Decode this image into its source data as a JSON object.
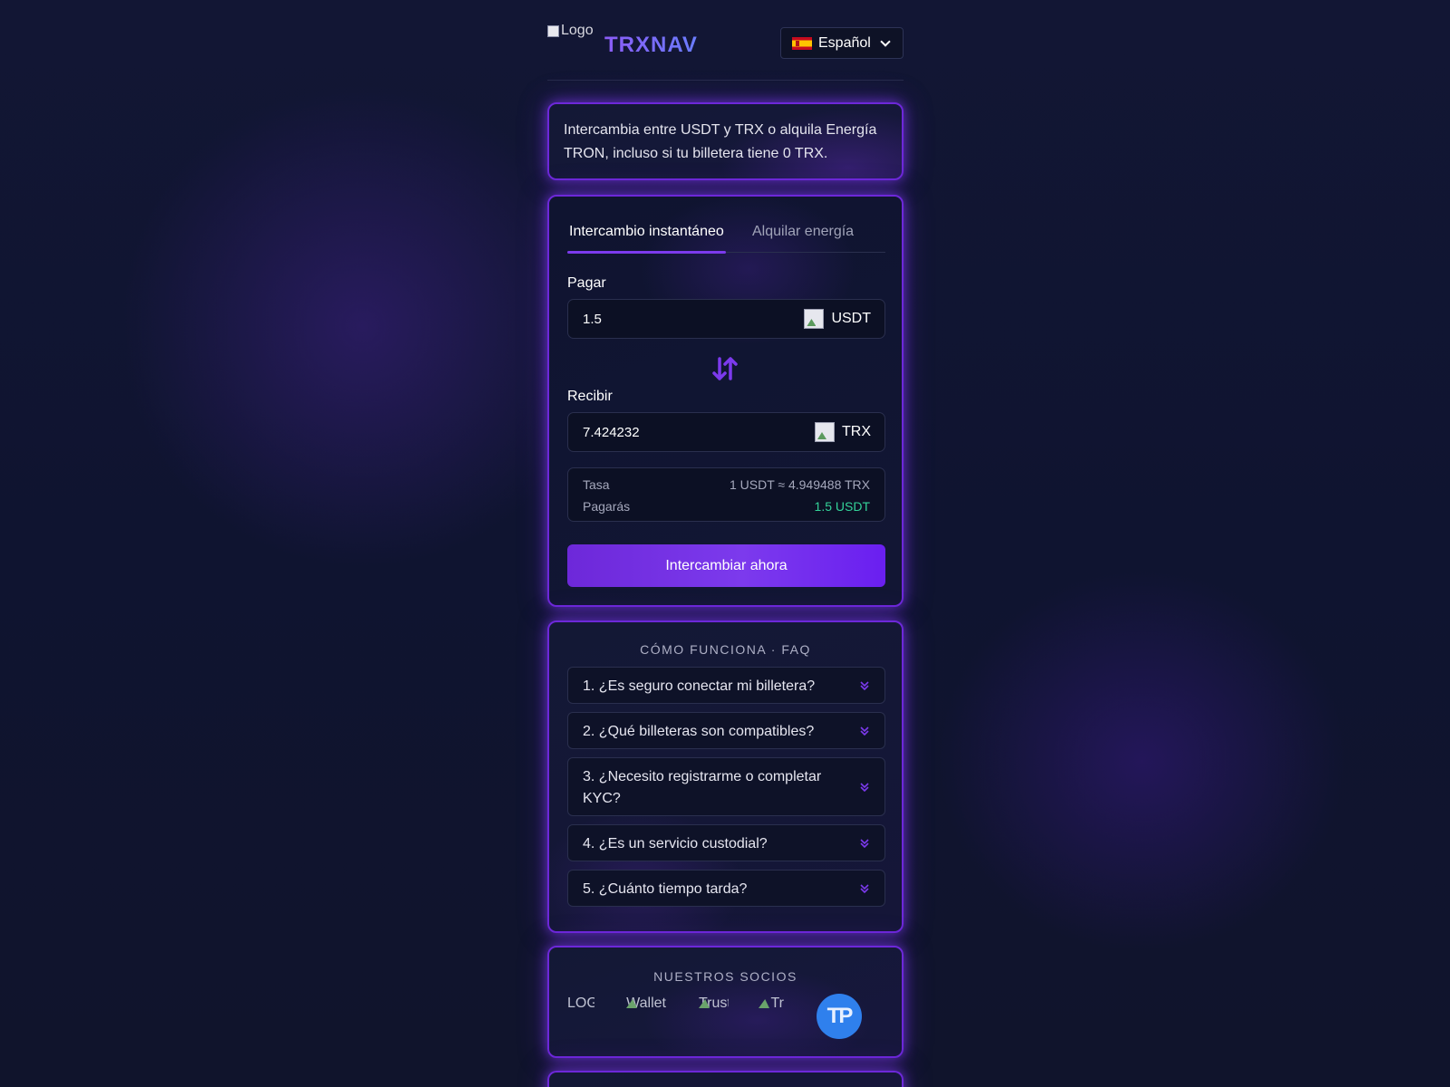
{
  "header": {
    "logo_alt": "Logo",
    "brand": "TRXNAV",
    "language": {
      "label": "Español",
      "flag_icon": "flag-es-icon"
    }
  },
  "intro": {
    "text": "Intercambia entre USDT y TRX o alquila Energía TRON, incluso si tu billetera tiene 0 TRX."
  },
  "swap": {
    "tabs": [
      {
        "label": "Intercambio instantáneo",
        "active": true
      },
      {
        "label": "Alquilar energía",
        "active": false
      }
    ],
    "pay": {
      "label": "Pagar",
      "value": "1.5",
      "token": "USDT"
    },
    "receive": {
      "label": "Recibir",
      "value": "7.424232",
      "token": "TRX"
    },
    "swap_icon": "swap-arrows-icon",
    "info": {
      "rate_label": "Tasa",
      "rate_value": "1 USDT ≈ 4.949488 TRX",
      "pay_label": "Pagarás",
      "pay_value": "1.5 USDT"
    },
    "submit_label": "Intercambiar ahora"
  },
  "faq": {
    "title": "CÓMO FUNCIONA · FAQ",
    "items": [
      {
        "question": "1. ¿Es seguro conectar mi billetera?"
      },
      {
        "question": "2. ¿Qué billeteras son compatibles?"
      },
      {
        "question": "3. ¿Necesito registrarme o completar KYC?"
      },
      {
        "question": "4. ¿Es un servicio custodial?"
      },
      {
        "question": "5. ¿Cuánto tiempo tarda?"
      }
    ]
  },
  "partners": {
    "title": "NUESTROS SOCIOS",
    "logos": [
      {
        "alt": "LOGO"
      },
      {
        "alt": "Wallet"
      },
      {
        "alt": "Trust"
      },
      {
        "alt": "Tr"
      },
      {
        "alt": "TP"
      }
    ]
  },
  "colors": {
    "accent": "#7c3aed",
    "brand_gradient_start": "#8b5cf6",
    "brand_gradient_end": "#6a7dff",
    "success": "#34d399",
    "background": "#121634",
    "partner_tp": "#2f80ed"
  }
}
